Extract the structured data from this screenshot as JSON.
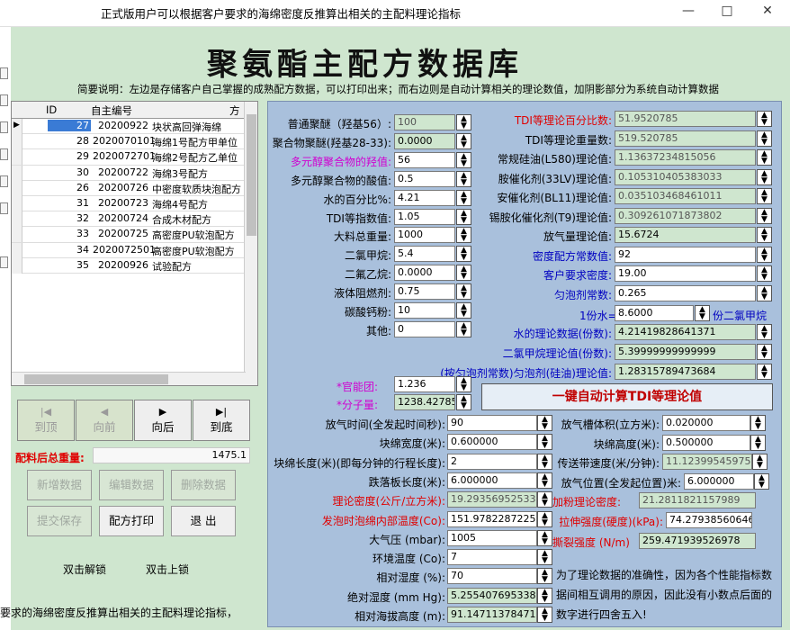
{
  "window": {
    "title": "正式版用户可以根据客户要求的海绵密度反推算出相关的主配料理论指标",
    "min": "—",
    "max": "□",
    "close": "✕"
  },
  "page_title": "聚氨酯主配方数据库",
  "description": "简要说明：左边是存储客户自己掌握的成熟配方数据，可以打印出来；而右边则是自动计算相关的理论数值，加阴影部分为系统自动计算数据",
  "grid": {
    "columns": [
      "ID",
      "自主编号",
      "方"
    ],
    "rows": [
      {
        "id": "27",
        "code": "20200922",
        "name": "块状高回弹海绵"
      },
      {
        "id": "28",
        "code": "2020070101",
        "name": "海绵1号配方甲单位"
      },
      {
        "id": "29",
        "code": "2020072701",
        "name": "海绵2号配方乙单位"
      },
      {
        "id": "30",
        "code": "20200722",
        "name": "海绵3号配方"
      },
      {
        "id": "26",
        "code": "20200726",
        "name": "中密度软质块泡配方"
      },
      {
        "id": "31",
        "code": "20200723",
        "name": "海绵4号配方"
      },
      {
        "id": "32",
        "code": "20200724",
        "name": "合成木材配方"
      },
      {
        "id": "33",
        "code": "20200725",
        "name": "高密度PU软泡配方"
      },
      {
        "id": "34",
        "code": "2020072501",
        "name": "高密度PU软泡配方"
      },
      {
        "id": "35",
        "code": "20200926",
        "name": "试验配方"
      }
    ]
  },
  "nav": {
    "first": "到顶",
    "prev": "向前",
    "next": "向后",
    "last": "到底",
    "first_icon": "|◀",
    "prev_icon": "◀",
    "next_icon": "▶",
    "last_icon": "▶|"
  },
  "total_weight": {
    "label": "配料后总重量:",
    "value": "1475.1"
  },
  "buttons": {
    "add": "新增数据",
    "edit": "编辑数据",
    "delete": "删除数据",
    "submit": "提交保存",
    "print": "配方打印",
    "exit": "退  出"
  },
  "hints": {
    "unlock": "双击解锁",
    "lock": "双击上锁"
  },
  "footer_text": "要求的海绵密度反推算出相关的主配料理论指标，",
  "left_fields": [
    {
      "label": "普通聚醚（羟基56）:",
      "value": "100"
    },
    {
      "label": "聚合物聚醚(羟基28-33):",
      "value": "0.0000"
    },
    {
      "label": "多元醇聚合物的羟值:",
      "value": "56"
    },
    {
      "label": "多元醇聚合物的酸值:",
      "value": "0.5"
    },
    {
      "label": "水的百分比%:",
      "value": "4.21"
    },
    {
      "label": "TDI等指数值:",
      "value": "1.05"
    },
    {
      "label": "大料总重量:",
      "value": "1000"
    },
    {
      "label": "二氯甲烷:",
      "value": "5.4"
    },
    {
      "label": "二氟乙烷:",
      "value": "0.0000"
    },
    {
      "label": "液体阻燃剂:",
      "value": "0.75"
    },
    {
      "label": "碳酸钙粉:",
      "value": "10"
    },
    {
      "label": "其他:",
      "value": "0"
    }
  ],
  "right_fields": [
    {
      "label": "TDI等理论百分比数:",
      "value": "51.9520785"
    },
    {
      "label": "TDI等理论重量数:",
      "value": "519.520785"
    },
    {
      "label": "常规硅油(L580)理论值:",
      "value": "1.13637234815056"
    },
    {
      "label": "胺催化剂(33LV)理论值:",
      "value": "0.105310405383033"
    },
    {
      "label": "安催化剂(BL11)理论值:",
      "value": "0.035103468461011"
    },
    {
      "label": "锡胺化催化剂(T9)理论值:",
      "value": "0.309261071873802"
    },
    {
      "label": "放气量理论值:",
      "value": "15.6724"
    },
    {
      "label": "密度配方常数值:",
      "value": "92"
    },
    {
      "label": "客户要求密度:",
      "value": "19.00"
    },
    {
      "label": "匀泡剂常数:",
      "value": "0.265"
    }
  ],
  "water_ratio": {
    "label": "1份水=",
    "value": "8.6000",
    "suffix": "份二氯甲烷"
  },
  "theory": [
    {
      "label": "水的理论数据(份数):",
      "value": "4.21419828641371"
    },
    {
      "label": "二氯甲烷理论值(份数):",
      "value": "5.39999999999999"
    },
    {
      "label": "(按匀泡剂常数)匀泡剂(硅油)理论值:",
      "value": "1.28315789473684"
    }
  ],
  "functional_group": {
    "label": "*官能团:",
    "value": "1.236"
  },
  "molecular_weight": {
    "label": "*分子量:",
    "value": "1238.427857"
  },
  "calc_button": "一键自动计算TDI等理论值",
  "bottom_left": [
    {
      "label": "放气时间(全发起时间秒):",
      "value": "90"
    },
    {
      "label": "块绵宽度(米):",
      "value": "0.600000"
    },
    {
      "label": "块绵长度(米)(即每分钟的行程长度):",
      "value": "2"
    },
    {
      "label": "跌落板长度(米):",
      "value": "6.000000"
    },
    {
      "label": "理论密度(公斤/立方米):",
      "value": "19.2935695253345"
    },
    {
      "label": "发泡时泡绵内部温度(Co):",
      "value": "151.9782287225"
    },
    {
      "label": "大气压 (mbar):",
      "value": "1005"
    },
    {
      "label": "环境温度 (Co):",
      "value": "7"
    },
    {
      "label": "相对湿度 (%):",
      "value": "70"
    },
    {
      "label": "绝对湿度 (mm Hg):",
      "value": "5.25540769533805"
    },
    {
      "label": "相对海拔高度 (m):",
      "value": "91.1471137847184"
    }
  ],
  "bottom_right": [
    {
      "label": "放气槽体积(立方米):",
      "value": "0.020000"
    },
    {
      "label": "块绵高度(米):",
      "value": "0.500000"
    },
    {
      "label": "传送带速度(米/分钟):",
      "value": "11.1239954597535"
    },
    {
      "label": "放气位置(全发起位置)米:",
      "value": "6.000000"
    },
    {
      "label": "加粉理论密度:",
      "value": "21.2811821157989"
    },
    {
      "label": "拉伸强度(硬度)(kPa):",
      "value": "74.279385606460"
    },
    {
      "label": "撕裂强度 (N/m)",
      "value": "259.471939526978"
    }
  ],
  "note": "为了理论数据的准确性，因为各个性能指标数据间相互调用的原因，因此没有小数点后面的数字进行四舍五入!"
}
